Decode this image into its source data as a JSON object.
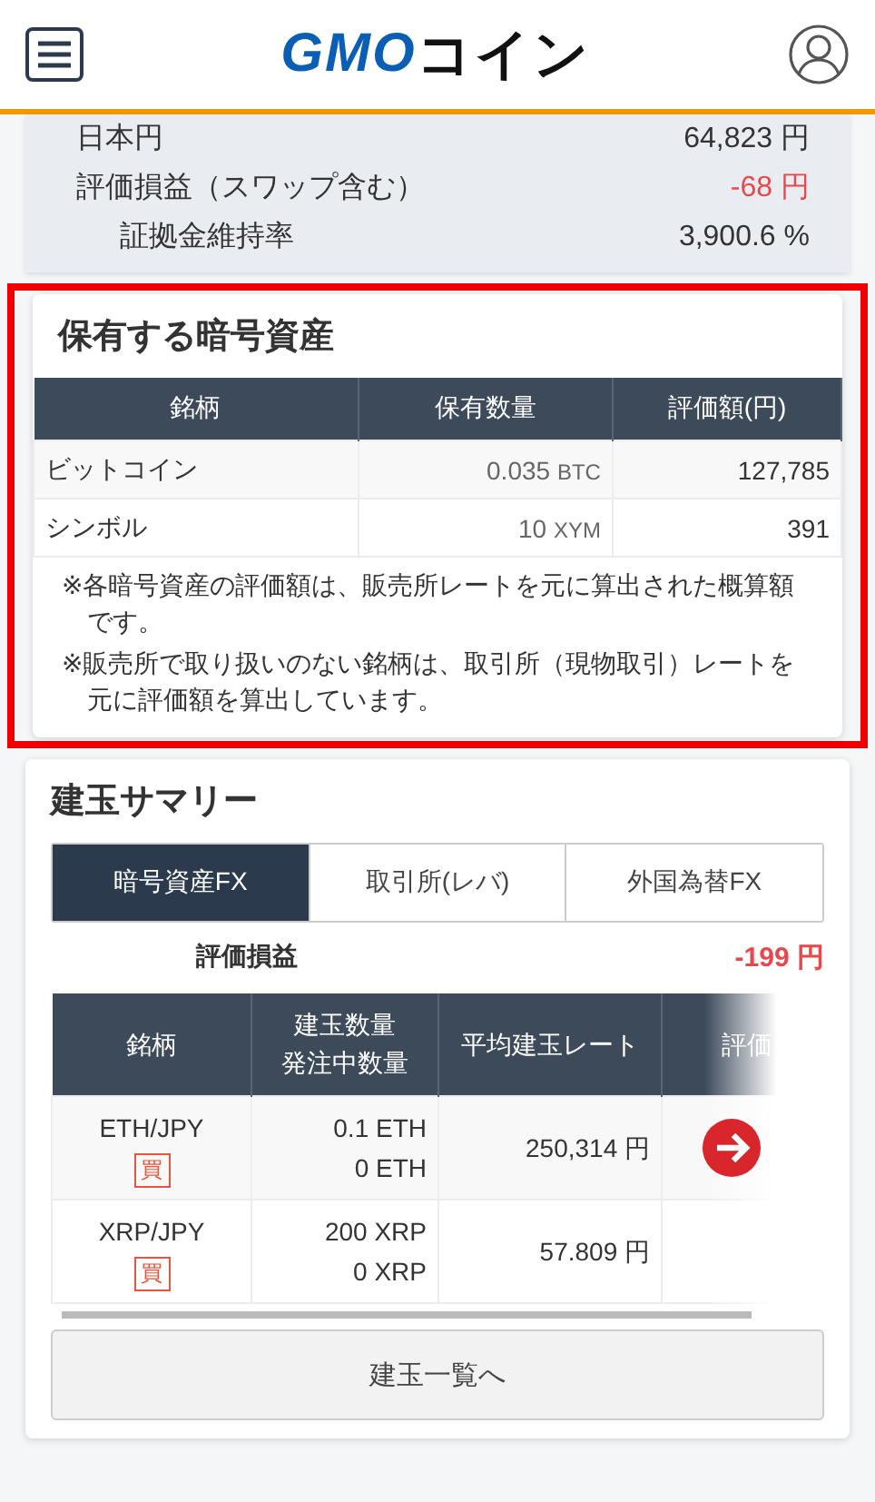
{
  "header": {
    "logo_latin": "GMO",
    "logo_kana": "コイン"
  },
  "balance_rows": [
    {
      "label": "日本円",
      "value": "64,823 円",
      "negative": false,
      "kind": "main"
    },
    {
      "label": "評価損益（スワップ含む）",
      "value": "-68 円",
      "negative": true,
      "kind": "main"
    },
    {
      "label": "証拠金維持率",
      "value": "3,900.6 %",
      "negative": false,
      "kind": "sub"
    }
  ],
  "holdings": {
    "title": "保有する暗号資産",
    "highlighted": true,
    "columns": [
      "銘柄",
      "保有数量",
      "評価額(円)"
    ],
    "rows": [
      {
        "name": "ビットコイン",
        "amount": "0.035",
        "unit": "BTC",
        "value": "127,785"
      },
      {
        "name": "シンボル",
        "amount": "10",
        "unit": "XYM",
        "value": "391"
      }
    ],
    "notes": [
      "※各暗号資産の評価額は、販売所レートを元に算出された概算額です。",
      "※販売所で取り扱いのない銘柄は、取引所（現物取引）レートを元に評価額を算出しています。"
    ]
  },
  "positions": {
    "title": "建玉サマリー",
    "tabs": [
      {
        "label": "暗号資産FX",
        "selected": true
      },
      {
        "label": "取引所(レバ)",
        "selected": false
      },
      {
        "label": "外国為替FX",
        "selected": false
      }
    ],
    "pl_label": "評価損益",
    "pl_value": "-199 円",
    "columns": [
      [
        "銘柄"
      ],
      [
        "建玉数量",
        "発注中数量"
      ],
      [
        "平均建玉レート"
      ],
      [
        "評価"
      ]
    ],
    "rows": [
      {
        "pair": "ETH/JPY",
        "side": "買",
        "quantity": "0.1 ETH",
        "pending": "0 ETH",
        "rate": "250,314 円",
        "has_link": true
      },
      {
        "pair": "XRP/JPY",
        "side": "買",
        "quantity": "200 XRP",
        "pending": "0 XRP",
        "rate": "57.809 円",
        "has_link": false
      }
    ],
    "button": "建玉一覧へ"
  }
}
